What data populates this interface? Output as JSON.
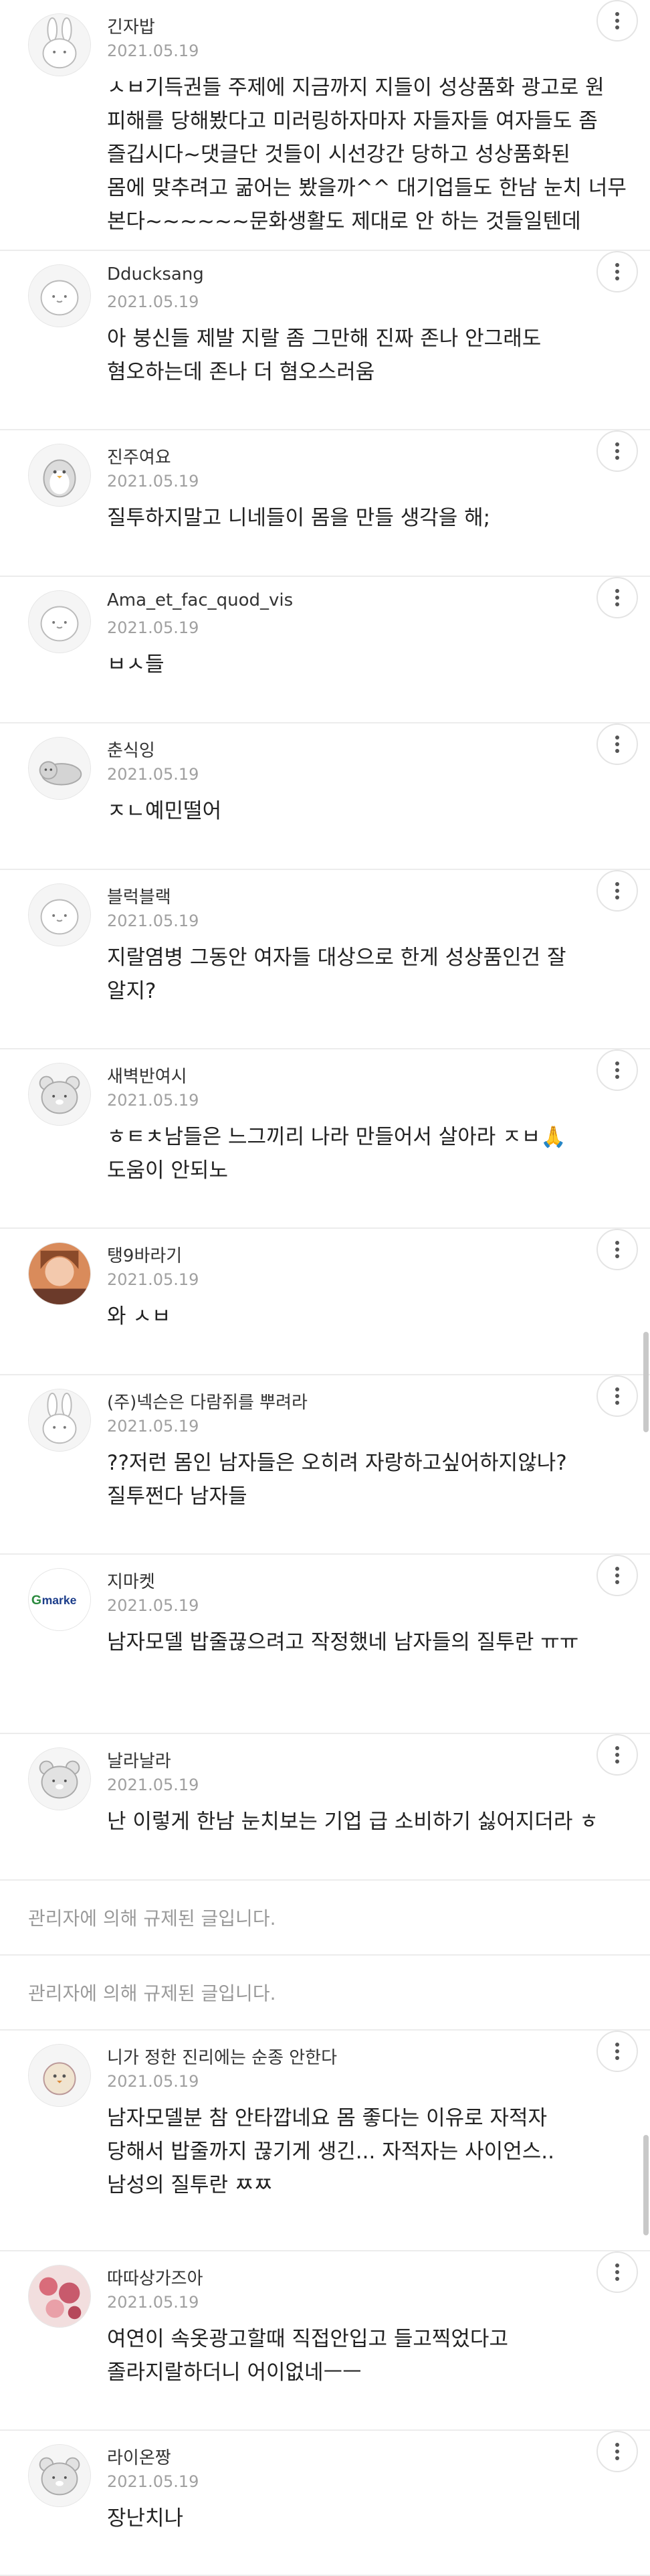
{
  "comments": [
    {
      "type": "comment",
      "username": "긴자밥",
      "date": "2021.05.19",
      "avatar": "rabbit-avatar",
      "lines": [
        "ㅅㅂ기득권들 주제에 지금까지 지들이 성상품화 광고로 원",
        "피해를 당해봤다고 미러링하자마자 자들자들 여자들도 좀",
        "즐깁시다~댓글단 것들이 시선강간 당하고 성상품화된",
        "몸에 맞추려고 굶어는 봤을까^^ 대기업들도 한남 눈치 너무",
        "본다~~~~~~문화생활도 제대로 안 하는 것들일텐데"
      ]
    },
    {
      "type": "comment",
      "username": "Dducksang",
      "date": "2021.05.19",
      "avatar": "blob-avatar",
      "lines": [
        "아 붕신들 제발 지랄 좀 그만해 진짜 존나 안그래도",
        "혐오하는데 존나 더 혐오스러움"
      ]
    },
    {
      "type": "comment",
      "username": "진주여요",
      "date": "2021.05.19",
      "avatar": "penguin-avatar",
      "lines": [
        "질투하지말고 니네들이 몸을 만들 생각을 해;"
      ]
    },
    {
      "type": "comment",
      "username": "Ama_et_fac_quod_vis",
      "date": "2021.05.19",
      "avatar": "blob-avatar",
      "lines": [
        "ㅂㅅ들"
      ]
    },
    {
      "type": "comment",
      "username": "춘식잉",
      "date": "2021.05.19",
      "avatar": "cat-avatar",
      "lines": [
        "ㅈㄴ예민떨어"
      ]
    },
    {
      "type": "comment",
      "username": "블럭블랙",
      "date": "2021.05.19",
      "avatar": "blob-avatar",
      "lines": [
        "지랄염병 그동안 여자들 대상으로 한게 성상품인건 잘",
        "알지?"
      ]
    },
    {
      "type": "comment",
      "username": "새벽반여시",
      "date": "2021.05.19",
      "avatar": "bear-avatar",
      "lines": [
        "ㅎㅌㅊ남들은 느그끼리 나라 만들어서 살아라 ㅈㅂ🙏",
        "도움이 안되노"
      ]
    },
    {
      "type": "comment",
      "username": "탱9바라기",
      "date": "2021.05.19",
      "avatar": "photo-avatar",
      "lines": [
        "와 ㅅㅂ"
      ]
    },
    {
      "type": "comment",
      "username": "(주)넥슨은 다람쥐를 뿌려라",
      "date": "2021.05.19",
      "avatar": "rabbit-avatar",
      "lines": [
        "??저런 몸인 남자들은 오히려 자랑하고싶어하지않나?",
        "질투쩐다 남자들"
      ]
    },
    {
      "type": "comment",
      "username": "지마켓",
      "date": "2021.05.19",
      "avatar": "gmarket-avatar",
      "avatar_text": "G marke",
      "lines": [
        "남자모델 밥줄끊으려고 작정했네 남자들의 질투란 ㅠㅠ"
      ]
    },
    {
      "type": "comment",
      "username": "날라날라",
      "date": "2021.05.19",
      "avatar": "bear-avatar",
      "lines": [
        "난 이렇게 한남 눈치보는 기업 급 소비하기 싫어지더라 ㅎ"
      ]
    },
    {
      "type": "removed",
      "text": "관리자에 의해 규제된 글입니다."
    },
    {
      "type": "removed",
      "text": "관리자에 의해 규제된 글입니다."
    },
    {
      "type": "comment",
      "username": "니가 정한 진리에는 순종 안한다",
      "date": "2021.05.19",
      "avatar": "chick-avatar",
      "lines": [
        "남자모델분 참 안타깝네요 몸 좋다는 이유로 자적자",
        "당해서 밥줄까지 끊기게 생긴... 자적자는 사이언스..",
        "남성의 질투란 ㅉㅉ"
      ]
    },
    {
      "type": "comment",
      "username": "따따상가즈아",
      "date": "2021.05.19",
      "avatar": "photo2-avatar",
      "lines": [
        "여연이 속옷광고할때 직접안입고 들고찍었다고",
        "졸라지랄하더니 어이없네ㅡㅡ"
      ]
    },
    {
      "type": "comment",
      "username": "라이온짱",
      "date": "2021.05.19",
      "avatar": "bear-avatar",
      "lines": [
        "장난치나"
      ]
    }
  ]
}
